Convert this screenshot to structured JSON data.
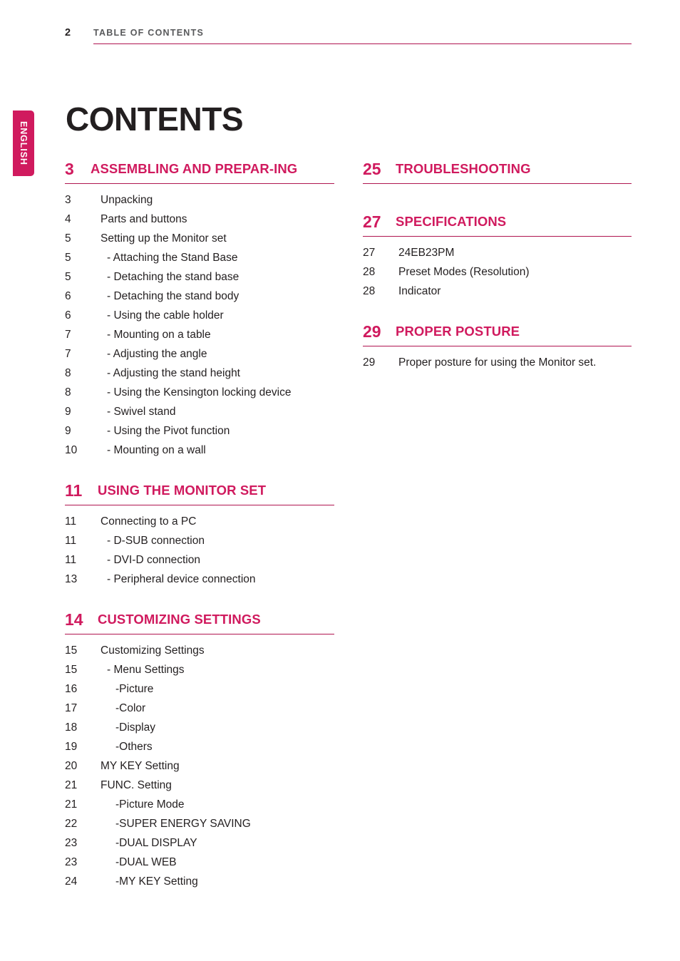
{
  "header": {
    "folio": "2",
    "title": "TABLE OF CONTENTS"
  },
  "language_tab": {
    "label": "ENGLISH"
  },
  "doc_title": "CONTENTS",
  "colors": {
    "accent": "#d01a5e",
    "rule": "#b01550",
    "text": "#231f20",
    "header_text": "#58595b"
  },
  "columns": {
    "left": {
      "sections": [
        {
          "number": "3",
          "title": "ASSEMBLING AND PREPAR-ING",
          "entries": [
            {
              "page": "3",
              "label": "Unpacking",
              "level": 1
            },
            {
              "page": "4",
              "label": "Parts and buttons",
              "level": 1
            },
            {
              "page": "5",
              "label": "Setting up the Monitor set",
              "level": 1
            },
            {
              "page": "5",
              "label": "- Attaching the Stand Base",
              "level": 2
            },
            {
              "page": "5",
              "label": "- Detaching the stand base",
              "level": 2
            },
            {
              "page": "6",
              "label": "- Detaching the stand body",
              "level": 2
            },
            {
              "page": "6",
              "label": "- Using the cable holder",
              "level": 2
            },
            {
              "page": "7",
              "label": "- Mounting on a table",
              "level": 2
            },
            {
              "page": "7",
              "label": "- Adjusting the angle",
              "level": 2
            },
            {
              "page": "8",
              "label": "- Adjusting the stand height",
              "level": 2
            },
            {
              "page": "8",
              "label": "- Using the Kensington locking device",
              "level": 2
            },
            {
              "page": "9",
              "label": "- Swivel stand",
              "level": 2
            },
            {
              "page": "9",
              "label": "- Using the Pivot function",
              "level": 2
            },
            {
              "page": "10",
              "label": "- Mounting on a wall",
              "level": 2
            }
          ]
        },
        {
          "number": "11",
          "title": "USING THE MONITOR SET",
          "entries": [
            {
              "page": "11",
              "label": "Connecting to a PC",
              "level": 1
            },
            {
              "page": "11",
              "label": "- D-SUB connection",
              "level": 2
            },
            {
              "page": "11",
              "label": "- DVI-D connection",
              "level": 2
            },
            {
              "page": "13",
              "label": "- Peripheral device connection",
              "level": 2
            }
          ]
        },
        {
          "number": "14",
          "title": "CUSTOMIZING SETTINGS",
          "entries": [
            {
              "page": "15",
              "label": "Customizing Settings",
              "level": 1
            },
            {
              "page": "15",
              "label": "- Menu Settings",
              "level": 2
            },
            {
              "page": "16",
              "label": "-Picture",
              "level": 3
            },
            {
              "page": "17",
              "label": "-Color",
              "level": 3
            },
            {
              "page": "18",
              "label": "-Display",
              "level": 3
            },
            {
              "page": "19",
              "label": "-Others",
              "level": 3
            },
            {
              "page": "20",
              "label": "MY KEY Setting",
              "level": 1
            },
            {
              "page": "21",
              "label": "FUNC. Setting",
              "level": 1
            },
            {
              "page": "21",
              "label": "-Picture Mode",
              "level": 3
            },
            {
              "page": "22",
              "label": "-SUPER ENERGY SAVING",
              "level": 3
            },
            {
              "page": "23",
              "label": "-DUAL DISPLAY",
              "level": 3
            },
            {
              "page": "23",
              "label": "-DUAL WEB",
              "level": 3
            },
            {
              "page": "24",
              "label": "-MY KEY Setting",
              "level": 3
            }
          ]
        }
      ]
    },
    "right": {
      "sections": [
        {
          "number": "25",
          "title": "TROUBLESHOOTING",
          "entries": []
        },
        {
          "number": "27",
          "title": "SPECIFICATIONS",
          "entries": [
            {
              "page": "27",
              "label": "24EB23PM",
              "level": 1
            },
            {
              "page": "28",
              "label": "Preset Modes (Resolution)",
              "level": 1
            },
            {
              "page": "28",
              "label": "Indicator",
              "level": 1
            }
          ]
        },
        {
          "number": "29",
          "title": "PROPER POSTURE",
          "entries": [
            {
              "page": "29",
              "label": "Proper posture for using the Monitor set.",
              "level": 1
            }
          ]
        }
      ]
    }
  }
}
